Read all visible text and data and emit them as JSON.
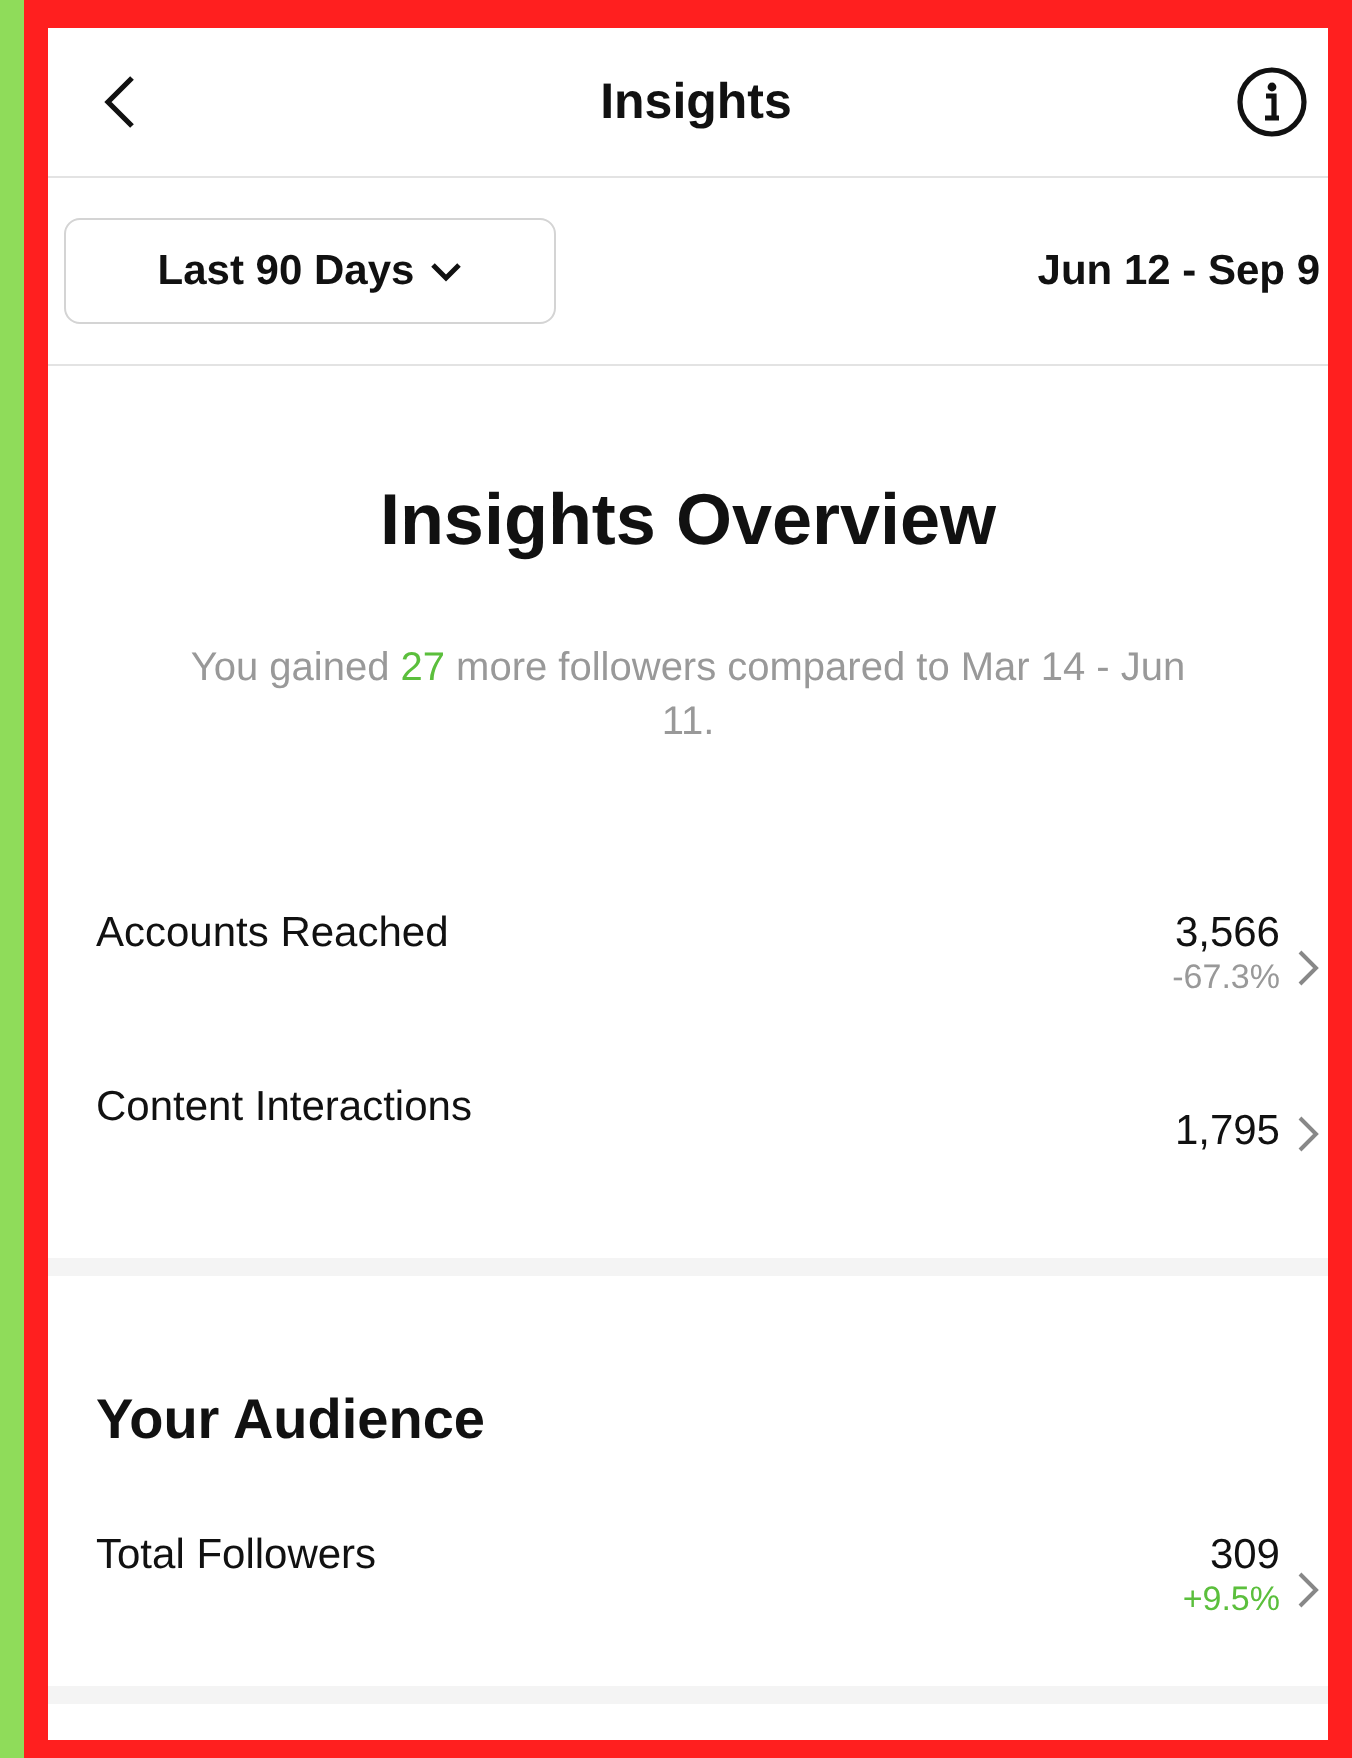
{
  "header": {
    "title": "Insights"
  },
  "filter": {
    "range_label": "Last 90 Days",
    "dates": "Jun 12 - Sep 9"
  },
  "overview": {
    "title": "Insights Overview",
    "summary_parts": [
      "You gained ",
      "27",
      " more followers compared to Mar 14 - Jun 11."
    ]
  },
  "metrics": [
    {
      "label": "Accounts Reached",
      "value": "3,566",
      "change": "-67.3%",
      "color": "#999999"
    },
    {
      "label": "Content Interactions",
      "value": "1,795"
    }
  ],
  "audience": {
    "title": "Your Audience",
    "metrics": [
      {
        "label": "Total Followers",
        "value": "309",
        "change": "+9.5%",
        "color": "#5bbf3c"
      }
    ]
  }
}
